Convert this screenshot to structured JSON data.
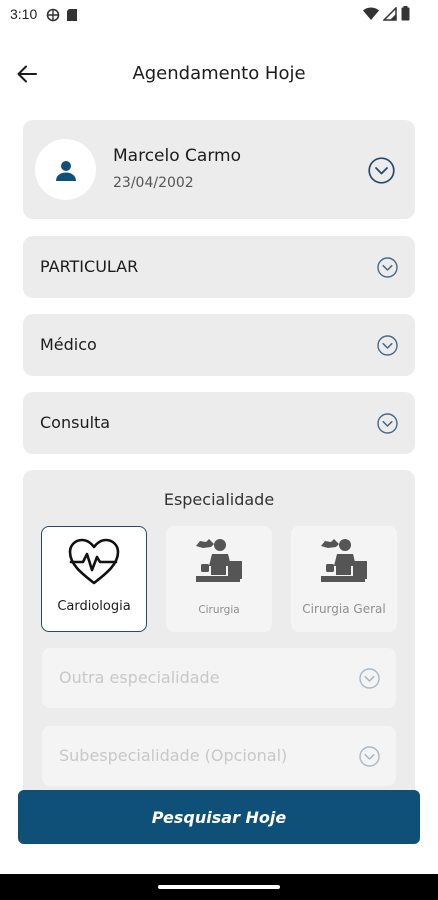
{
  "status_bar": {
    "time": "3:10"
  },
  "header": {
    "title": "Agendamento Hoje"
  },
  "patient": {
    "name": "Marcelo Carmo",
    "birth_date": "23/04/2002"
  },
  "selects": [
    {
      "label": "PARTICULAR"
    },
    {
      "label": "Médico"
    },
    {
      "label": "Consulta"
    }
  ],
  "specialty": {
    "title": "Especialidade",
    "options": [
      {
        "label": "Cardiologia",
        "selected": true
      },
      {
        "label": "Cirurgia",
        "selected": false
      },
      {
        "label": "Cirurgia Geral",
        "selected": false
      }
    ],
    "other_placeholder": "Outra especialidade",
    "sub_placeholder": "Subespecialidade (Opcional)"
  },
  "actions": {
    "search_label": "Pesquisar Hoje"
  },
  "colors": {
    "primary": "#0e5078",
    "card_bg": "#ececec",
    "selected_border": "#284a66"
  }
}
